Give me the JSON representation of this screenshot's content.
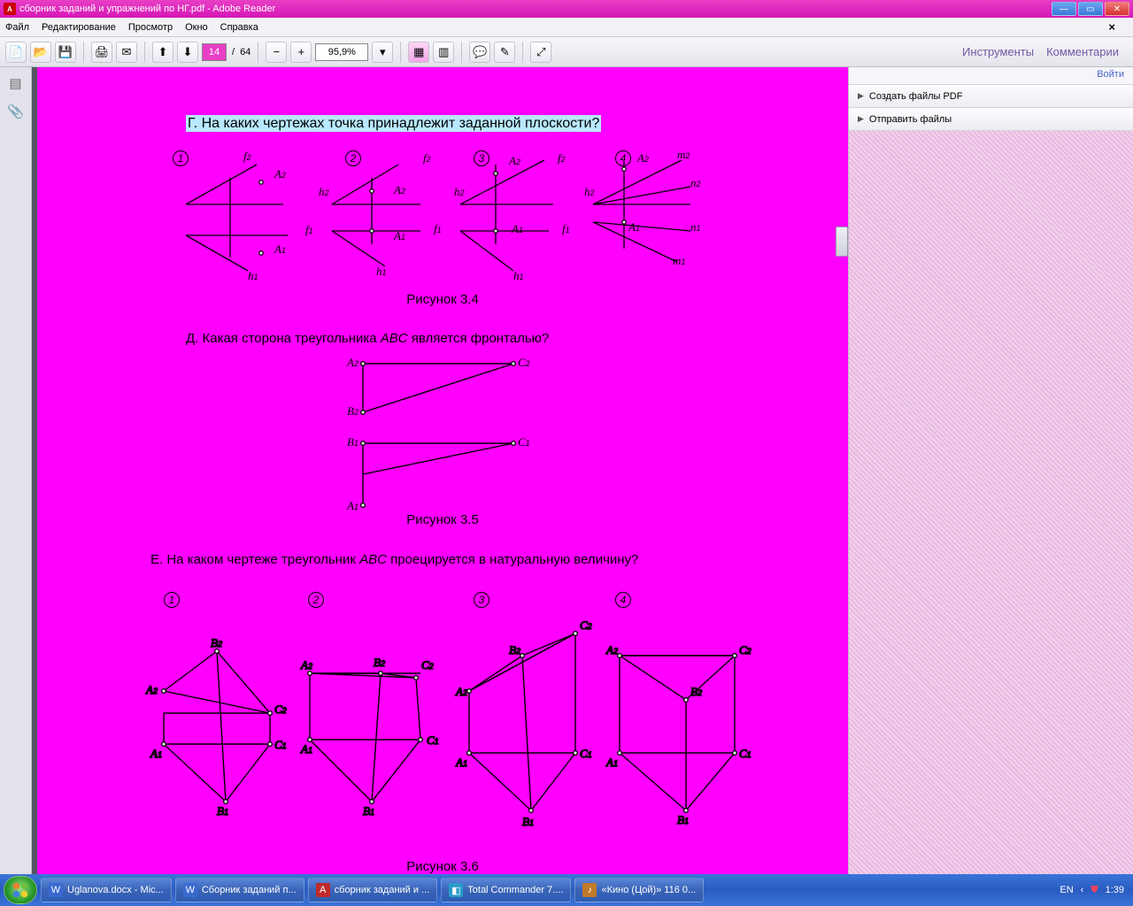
{
  "window": {
    "title": "сборник заданий и упражнений по НГ.pdf - Adobe Reader"
  },
  "menu": {
    "file": "Файл",
    "edit": "Редактирование",
    "view": "Просмотр",
    "window": "Окно",
    "help": "Справка"
  },
  "toolbar": {
    "page": "14",
    "pages": "64",
    "sep": "/",
    "zoom": "95,9%",
    "tools": "Инструменты",
    "comments": "Комментарии"
  },
  "rightpane": {
    "login": "Войти",
    "create": "Создать файлы PDF",
    "send": "Отправить файлы"
  },
  "doc": {
    "qG": "Г. На каких чертежах точка принадлежит заданной плоскости?",
    "opts": [
      "1",
      "2",
      "3",
      "4"
    ],
    "fig34": "Рисунок 3.4",
    "qD_a": "Д. Какая сторона треугольника ",
    "qD_abc": "ABC",
    "qD_b": " является фронталью?",
    "fig35": "Рисунок 3.5",
    "qE_a": "Е. На каком чертеже треугольник ",
    "qE_abc": "ABC",
    "qE_b": " проецируется в натуральную величину?",
    "fig36": "Рисунок 3.6",
    "lbl": {
      "A1": "A₁",
      "A2": "A₂",
      "B1": "B₁",
      "B2": "B₂",
      "C1": "C₁",
      "C2": "C₂",
      "f1": "f₁",
      "f2": "f₂",
      "h1": "h₁",
      "h2": "h₂",
      "m1": "m₁",
      "m2": "m₂",
      "n1": "n₁",
      "n2": "n₂"
    }
  },
  "taskbar": {
    "items": [
      {
        "label": "Uglanova.docx - Mic...",
        "color": "#2a5cc0"
      },
      {
        "label": "Сборник заданий п...",
        "color": "#2a5cc0"
      },
      {
        "label": "сборник заданий и ...",
        "color": "#c02a2a"
      },
      {
        "label": "Total Commander 7....",
        "color": "#2a9aca"
      },
      {
        "label": "«Кино (Цой)» 116 0...",
        "color": "#c07a2a"
      }
    ],
    "lang": "EN",
    "time": "1:39"
  }
}
